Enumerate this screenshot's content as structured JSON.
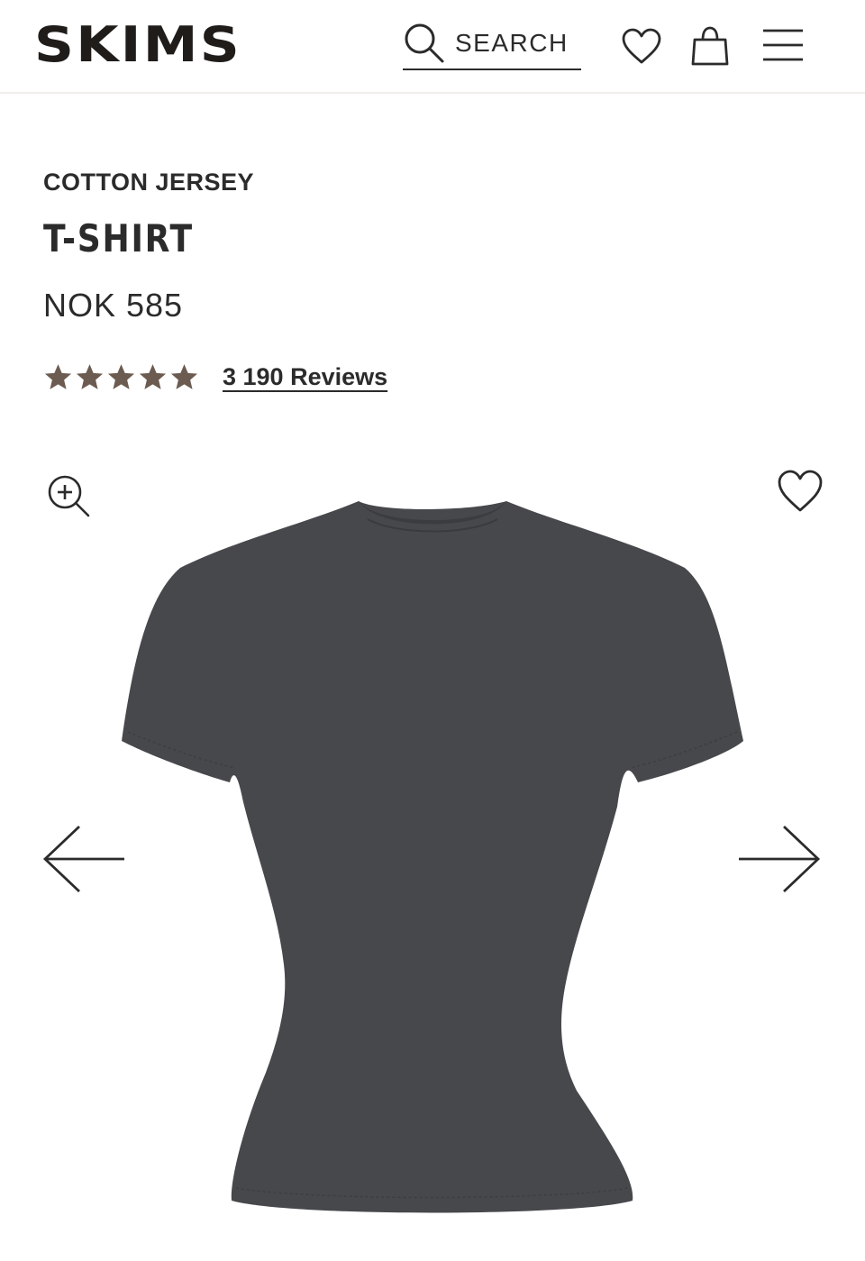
{
  "header": {
    "brand": "SKIMS",
    "search_label": "SEARCH",
    "icons": {
      "search": "search-icon",
      "wishlist": "heart-icon",
      "bag": "shopping-bag-icon",
      "menu": "hamburger-menu-icon"
    }
  },
  "product": {
    "category": "COTTON JERSEY",
    "title": "T-SHIRT",
    "price": "NOK 585",
    "rating": {
      "stars": 5,
      "reviews_label": "3 190 Reviews"
    }
  },
  "gallery": {
    "image_alt": "T-shirt product image",
    "icons": {
      "zoom": "zoom-in-icon",
      "wishlist": "heart-icon",
      "prev": "arrow-left-icon",
      "next": "arrow-right-icon"
    }
  },
  "colors": {
    "text": "#2b2b2b",
    "star": "#6b5b50",
    "shirt": "#47484c",
    "divider": "#f0eeea"
  }
}
